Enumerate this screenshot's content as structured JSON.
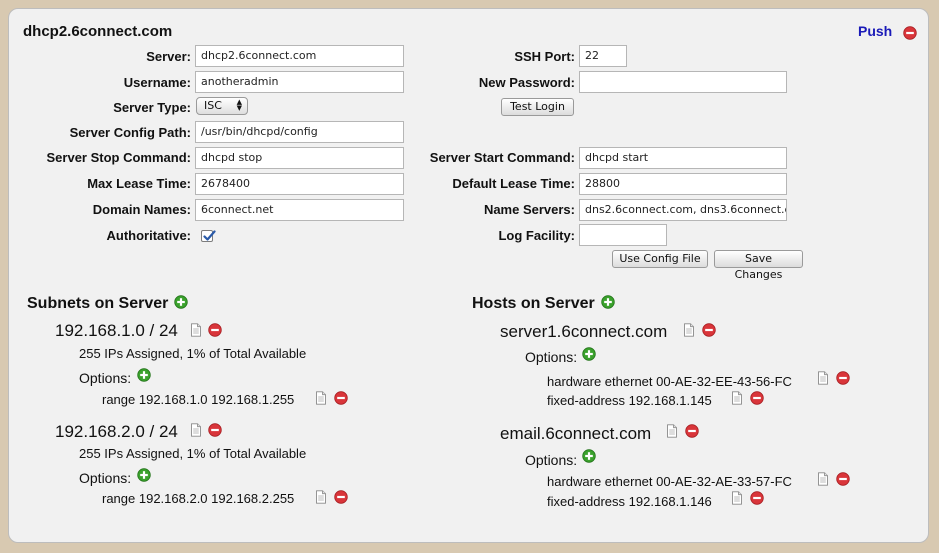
{
  "server_title": "dhcp2.6connect.com",
  "push_label": "Push",
  "form": {
    "server_label": "Server:",
    "server_value": "dhcp2.6connect.com",
    "username_label": "Username:",
    "username_value": "anotheradmin",
    "server_type_label": "Server Type:",
    "server_type_value": "ISC",
    "config_path_label": "Server Config Path:",
    "config_path_value": "/usr/bin/dhcpd/config",
    "stop_cmd_label": "Server Stop Command:",
    "stop_cmd_value": "dhcpd stop",
    "max_lease_label": "Max Lease Time:",
    "max_lease_value": "2678400",
    "domain_names_label": "Domain Names:",
    "domain_names_value": "6connect.net",
    "authoritative_label": "Authoritative:",
    "authoritative_checked": true,
    "ssh_port_label": "SSH Port:",
    "ssh_port_value": "22",
    "new_password_label": "New Password:",
    "new_password_value": "",
    "test_login_label": "Test Login",
    "start_cmd_label": "Server Start Command:",
    "start_cmd_value": "dhcpd start",
    "default_lease_label": "Default Lease Time:",
    "default_lease_value": "28800",
    "name_servers_label": "Name Servers:",
    "name_servers_value": "dns2.6connect.com, dns3.6connect.c",
    "log_facility_label": "Log Facility:",
    "log_facility_value": "",
    "use_config_file_label": "Use Config File",
    "save_changes_label": "Save Changes"
  },
  "subnets": {
    "heading": "Subnets on Server",
    "items": [
      {
        "name": "192.168.1.0 / 24",
        "assigned": "255 IPs Assigned, 1% of Total Available",
        "options_label": "Options:",
        "options": [
          "range 192.168.1.0 192.168.1.255"
        ]
      },
      {
        "name": "192.168.2.0 / 24",
        "assigned": "255 IPs Assigned, 1% of Total Available",
        "options_label": "Options:",
        "options": [
          "range 192.168.2.0 192.168.2.255"
        ]
      }
    ]
  },
  "hosts": {
    "heading": "Hosts on Server",
    "items": [
      {
        "name": "server1.6connect.com",
        "options_label": "Options:",
        "options": [
          "hardware ethernet 00-AE-32-EE-43-56-FC",
          "fixed-address 192.168.1.145"
        ]
      },
      {
        "name": "email.6connect.com",
        "options_label": "Options:",
        "options": [
          "hardware ethernet 00-AE-32-AE-33-57-FC",
          "fixed-address 192.168.1.146"
        ]
      }
    ]
  },
  "icons": {
    "add": "green-plus-circle-icon",
    "remove": "red-minus-circle-icon",
    "edit": "document-edit-icon"
  },
  "colors": {
    "push": "#1a1ab8",
    "add_icon": "#3aa12c",
    "remove_icon": "#d9353a",
    "check": "#2a5aa8"
  }
}
